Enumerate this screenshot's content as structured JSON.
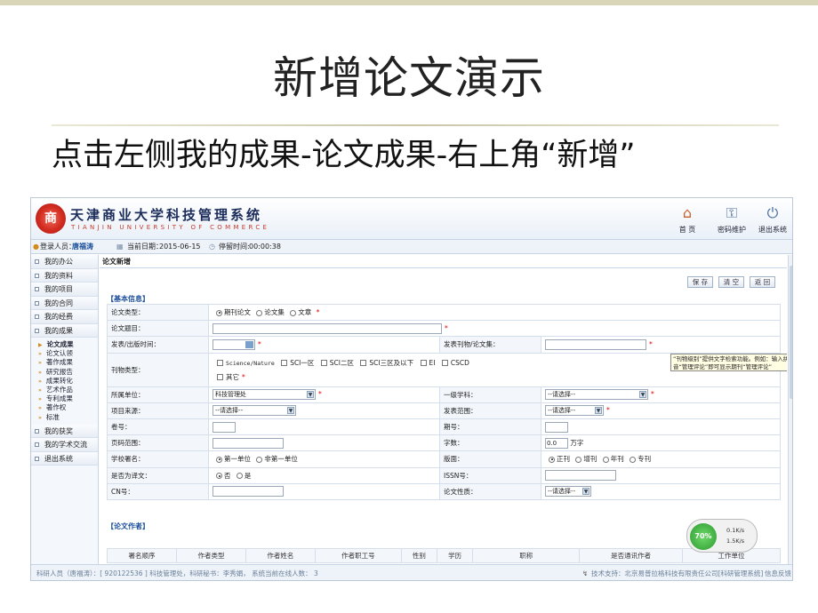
{
  "slide": {
    "title": "新增论文演示",
    "subtitle": "点击左侧我的成果-论文成果-右上角“新增”"
  },
  "app": {
    "name": "天津商业大学科技管理系统",
    "name_en": "TIANJIN UNIVERSITY OF COMMERCE",
    "header_buttons": [
      {
        "label": "首 页",
        "icon": "home-icon"
      },
      {
        "label": "密码维护",
        "icon": "key-icon"
      },
      {
        "label": "退出系统",
        "icon": "exit-icon"
      }
    ]
  },
  "infobar": {
    "user_label": "登录人员：",
    "user": "唐福涛",
    "date_label": "当前日期：",
    "date": "2015-06-15",
    "stay_label": "停留时间:",
    "stay": "00:00:38"
  },
  "sidebar": {
    "items_top": [
      "我的办公",
      "我的资料",
      "我的项目",
      "我的合同",
      "我的经费",
      "我的成果"
    ],
    "sub_items": [
      "论文成果",
      "论文认领",
      "著作成果",
      "研究报告",
      "成果转化",
      "艺术作品",
      "专利成果",
      "著作权",
      "标准"
    ],
    "items_bottom": [
      "我的获奖",
      "我的学术交流",
      "退出系统"
    ]
  },
  "main": {
    "tab": "论文新增",
    "buttons": {
      "save": "保 存",
      "clear": "清 空",
      "back": "返 回"
    },
    "basic_section": "【基本信息】",
    "author_section": "【论文作者】",
    "tooltip": "“刊物级别”提供文字检索功能。例如：输入拼音“管理评论”即可显示期刊“管理评论”",
    "form": {
      "paper_type": {
        "label": "论文类型：",
        "options": [
          "期刊论文",
          "论文集",
          "文章"
        ]
      },
      "title": {
        "label": "论文题目："
      },
      "publish_time": {
        "label": "发表/出版时间："
      },
      "journal": {
        "label": "发表刊物/论文集："
      },
      "journal_type": {
        "label": "刊物类型：",
        "options": [
          "Science/Nature",
          "SCI一区",
          "SCI二区",
          "SCI三区及以下",
          "EI",
          "CSCD",
          "其它"
        ]
      },
      "unit": {
        "label": "所属单位：",
        "value": "科技管理处"
      },
      "discipline": {
        "label": "一级学科：",
        "value": "--请选择--"
      },
      "source": {
        "label": "项目来源：",
        "value": "--请选择--"
      },
      "scope": {
        "label": "发表范围：",
        "value": "--请选择--"
      },
      "volume": {
        "label": "卷号："
      },
      "issue": {
        "label": "期号："
      },
      "pages": {
        "label": "页码范围："
      },
      "words": {
        "label": "字数：",
        "value": "0.0",
        "unit": "万字"
      },
      "sign": {
        "label": "学校署名：",
        "options": [
          "第一单位",
          "非第一单位"
        ]
      },
      "layout": {
        "label": "版面：",
        "options": [
          "正刊",
          "增刊",
          "年刊",
          "专刊"
        ]
      },
      "translation": {
        "label": "是否为译文：",
        "options": [
          "否",
          "是"
        ]
      },
      "issn": {
        "label": "ISSN号："
      },
      "cn": {
        "label": "CN号："
      },
      "nature": {
        "label": "论文性质：",
        "value": "--请选择--"
      }
    },
    "author_columns": [
      "署名顺序",
      "作者类型",
      "作者姓名",
      "作者职工号",
      "性别",
      "学历",
      "职称",
      "是否通讯作者",
      "工作单位"
    ]
  },
  "perf": {
    "percent": "70%",
    "up": "0.1K/s",
    "down": "1.5K/s"
  },
  "status": {
    "left": "科研人员（唐福涛）：[ 920122536 ] 科技管理处，科研秘书：李秀娟， 系统当前在线人数： 3",
    "right": "技术支持：北京易普拉格科技有限责任公司[科研管理系统]",
    "feedback": "信息反馈"
  }
}
